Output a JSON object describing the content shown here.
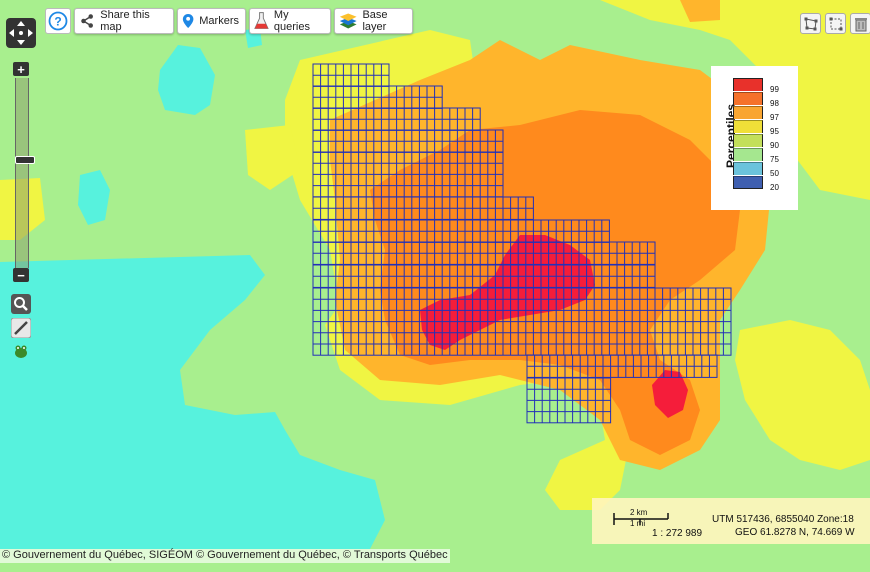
{
  "toolbar": {
    "share_label": "Share this map",
    "markers_label": "Markers",
    "queries_label": "My queries",
    "base_layer_label": "Base layer"
  },
  "zoom": {
    "plus": "+",
    "minus": "−"
  },
  "legend": {
    "title": "Percentiles",
    "entries": [
      {
        "label": "99",
        "color": "#e8312b"
      },
      {
        "label": "98",
        "color": "#f5712a"
      },
      {
        "label": "97",
        "color": "#f9a531"
      },
      {
        "label": "95",
        "color": "#f0df38"
      },
      {
        "label": "90",
        "color": "#c3df5a"
      },
      {
        "label": "75",
        "color": "#a5e78f"
      },
      {
        "label": "50",
        "color": "#6bc3dc"
      },
      {
        "label": "20",
        "color": "#3f5fb0"
      }
    ]
  },
  "scale": {
    "km_label": "2 km",
    "mi_label": "1 mi",
    "ratio": "1 : 272 989"
  },
  "coords": {
    "utm": "UTM 517436, 6855040 Zone:18",
    "geo": "GEO 61.8278 N, 74.669 W"
  },
  "attribution": "© Gouvernement du Québec, SIGÉOM © Gouvernement du Québec, © Transports Québec",
  "map_colors": {
    "green": "#a8ef8e",
    "cyan": "#57f2dd",
    "yellow": "#f0f543",
    "orange_light": "#ffb52c",
    "orange": "#ff8a1d",
    "red": "#f51d3a",
    "grid": "#2230b8"
  }
}
